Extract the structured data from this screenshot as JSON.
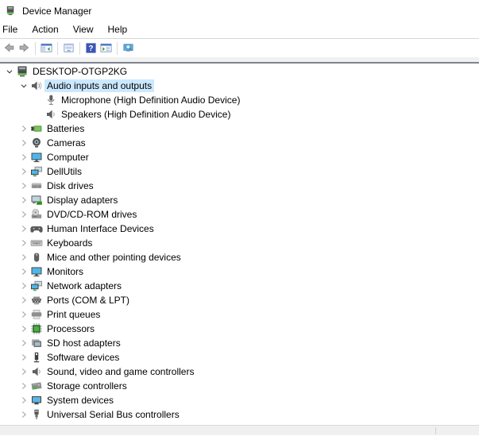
{
  "window": {
    "title": "Device Manager"
  },
  "menu": {
    "items": [
      "File",
      "Action",
      "View",
      "Help"
    ]
  },
  "toolbar": {
    "buttons": [
      {
        "name": "back",
        "icon": "arrow-left-icon",
        "enabled": false
      },
      {
        "name": "forward",
        "icon": "arrow-right-icon",
        "enabled": false
      },
      {
        "sep": true
      },
      {
        "name": "show-console-tree",
        "icon": "console-tree-icon",
        "enabled": true
      },
      {
        "sep": true
      },
      {
        "name": "properties",
        "icon": "properties-window-icon",
        "enabled": true
      },
      {
        "sep": true
      },
      {
        "name": "help",
        "icon": "help-icon",
        "enabled": true
      },
      {
        "name": "show-action-pane",
        "icon": "action-pane-icon",
        "enabled": true
      },
      {
        "sep": true
      },
      {
        "name": "scan-for-hardware-changes",
        "icon": "scan-hardware-icon",
        "enabled": true
      }
    ]
  },
  "tree": {
    "items": [
      {
        "label": "DESKTOP-OTGP2KG",
        "level": 0,
        "expand": "expanded",
        "icon": "computer-system",
        "selected": false
      },
      {
        "label": "Audio inputs and outputs",
        "level": 1,
        "expand": "expanded",
        "icon": "audio-device",
        "selected": true
      },
      {
        "label": "Microphone (High Definition Audio Device)",
        "level": 2,
        "expand": "leaf",
        "icon": "microphone",
        "selected": false
      },
      {
        "label": "Speakers (High Definition Audio Device)",
        "level": 2,
        "expand": "leaf",
        "icon": "speaker",
        "selected": false
      },
      {
        "label": "Batteries",
        "level": 1,
        "expand": "collapsed",
        "icon": "battery",
        "selected": false
      },
      {
        "label": "Cameras",
        "level": 1,
        "expand": "collapsed",
        "icon": "camera",
        "selected": false
      },
      {
        "label": "Computer",
        "level": 1,
        "expand": "collapsed",
        "icon": "computer",
        "selected": false
      },
      {
        "label": "DellUtils",
        "level": 1,
        "expand": "collapsed",
        "icon": "network-computer",
        "selected": false
      },
      {
        "label": "Disk drives",
        "level": 1,
        "expand": "collapsed",
        "icon": "disk-drive",
        "selected": false
      },
      {
        "label": "Display adapters",
        "level": 1,
        "expand": "collapsed",
        "icon": "display-adapter",
        "selected": false
      },
      {
        "label": "DVD/CD-ROM drives",
        "level": 1,
        "expand": "collapsed",
        "icon": "dvd-drive",
        "selected": false
      },
      {
        "label": "Human Interface Devices",
        "level": 1,
        "expand": "collapsed",
        "icon": "gamepad",
        "selected": false
      },
      {
        "label": "Keyboards",
        "level": 1,
        "expand": "collapsed",
        "icon": "keyboard",
        "selected": false
      },
      {
        "label": "Mice and other pointing devices",
        "level": 1,
        "expand": "collapsed",
        "icon": "mouse",
        "selected": false
      },
      {
        "label": "Monitors",
        "level": 1,
        "expand": "collapsed",
        "icon": "monitor",
        "selected": false
      },
      {
        "label": "Network adapters",
        "level": 1,
        "expand": "collapsed",
        "icon": "network-computer",
        "selected": false
      },
      {
        "label": "Ports (COM & LPT)",
        "level": 1,
        "expand": "collapsed",
        "icon": "serial-port",
        "selected": false
      },
      {
        "label": "Print queues",
        "level": 1,
        "expand": "collapsed",
        "icon": "printer",
        "selected": false
      },
      {
        "label": "Processors",
        "level": 1,
        "expand": "collapsed",
        "icon": "processor",
        "selected": false
      },
      {
        "label": "SD host adapters",
        "level": 1,
        "expand": "collapsed",
        "icon": "sd-card",
        "selected": false
      },
      {
        "label": "Software devices",
        "level": 1,
        "expand": "collapsed",
        "icon": "software-device",
        "selected": false
      },
      {
        "label": "Sound, video and game controllers",
        "level": 1,
        "expand": "collapsed",
        "icon": "speaker",
        "selected": false
      },
      {
        "label": "Storage controllers",
        "level": 1,
        "expand": "collapsed",
        "icon": "storage-controller",
        "selected": false
      },
      {
        "label": "System devices",
        "level": 1,
        "expand": "collapsed",
        "icon": "system-device",
        "selected": false
      },
      {
        "label": "Universal Serial Bus controllers",
        "level": 1,
        "expand": "collapsed",
        "icon": "usb-plug",
        "selected": false
      }
    ]
  },
  "colors": {
    "selection_bg": "#cce8ff",
    "toolbar_band_border": "#7f8590",
    "menubar_border": "#d7d7d7",
    "statusbar_bg": "#f0f0f0",
    "help_icon_bg": "#3c55b4",
    "accent_green": "#4caf3f",
    "accent_blue": "#4fb6ea",
    "text": "#000000"
  }
}
